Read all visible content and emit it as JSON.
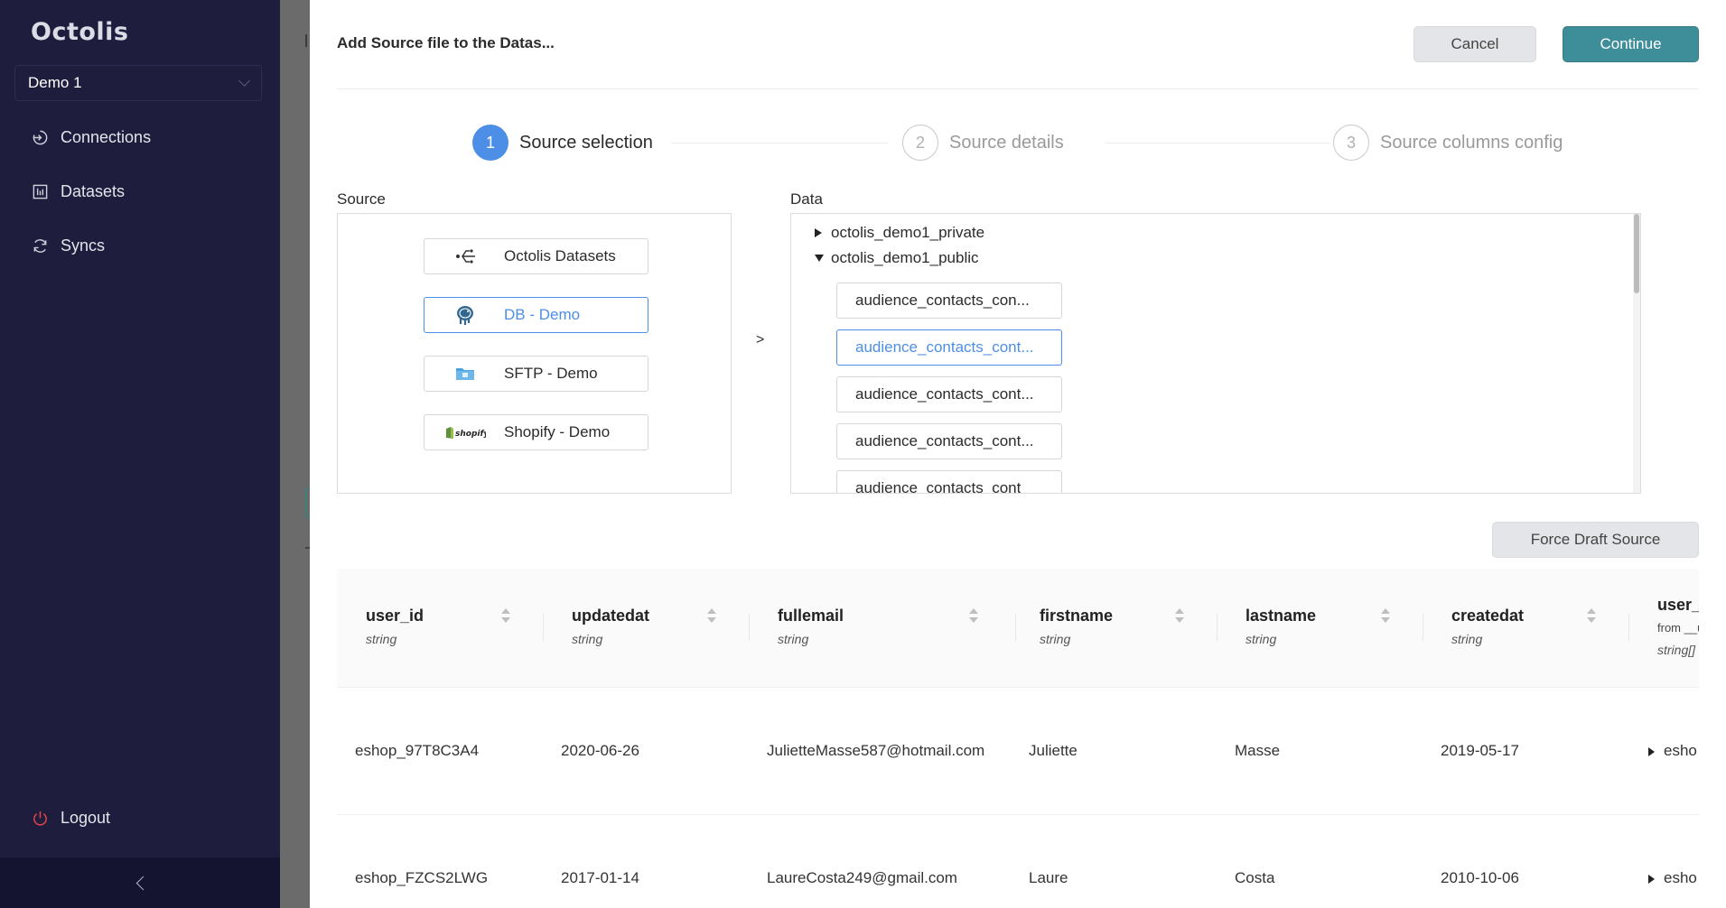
{
  "sidebar": {
    "logo": "Octolis",
    "workspace": "Demo 1",
    "nav": [
      {
        "label": "Connections",
        "icon": "connections-icon"
      },
      {
        "label": "Datasets",
        "icon": "datasets-icon"
      },
      {
        "label": "Syncs",
        "icon": "syncs-icon"
      }
    ],
    "logout": "Logout"
  },
  "drawer": {
    "title": "Add Source file to the Datas...",
    "cancel_label": "Cancel",
    "continue_label": "Continue",
    "force_label": "Force Draft Source"
  },
  "steps": [
    {
      "num": "1",
      "label": "Source selection",
      "state": "active"
    },
    {
      "num": "2",
      "label": "Source details",
      "state": "pending"
    },
    {
      "num": "3",
      "label": "Source columns config",
      "state": "pending"
    }
  ],
  "source": {
    "label": "Source",
    "items": [
      {
        "label": "Octolis Datasets",
        "icon": "octolis-datasets-icon",
        "selected": false
      },
      {
        "label": "DB - Demo",
        "icon": "postgres-elephant-icon",
        "selected": true
      },
      {
        "label": "SFTP - Demo",
        "icon": "folder-icon",
        "selected": false
      },
      {
        "label": "Shopify - Demo",
        "icon": "shopify-logo-icon",
        "selected": false
      }
    ],
    "shopify_logo_text": "shopify",
    "arrow": ">"
  },
  "data": {
    "label": "Data",
    "nodes": [
      {
        "label": "octolis_demo1_private",
        "expanded": false
      },
      {
        "label": "octolis_demo1_public",
        "expanded": true
      }
    ],
    "leaves": [
      {
        "label": "audience_contacts_con...",
        "selected": false
      },
      {
        "label": "audience_contacts_cont...",
        "selected": true
      },
      {
        "label": "audience_contacts_cont...",
        "selected": false
      },
      {
        "label": "audience_contacts_cont...",
        "selected": false
      },
      {
        "label": "audience_contacts_cont",
        "selected": false
      }
    ]
  },
  "table": {
    "columns": [
      {
        "name": "user_id",
        "type": "string"
      },
      {
        "name": "updatedat",
        "type": "string"
      },
      {
        "name": "fullemail",
        "type": "string"
      },
      {
        "name": "firstname",
        "type": "string"
      },
      {
        "name": "lastname",
        "type": "string"
      },
      {
        "name": "createdat",
        "type": "string"
      },
      {
        "name": "user_id",
        "from": "from __u",
        "type": "string[]"
      }
    ],
    "rows": [
      [
        "eshop_97T8C3A4",
        "2020-06-26",
        "JulietteMasse587@hotmail.com",
        "Juliette",
        "Masse",
        "2019-05-17",
        "esho"
      ],
      [
        "eshop_FZCS2LWG",
        "2017-01-14",
        "LaureCosta249@gmail.com",
        "Laure",
        "Costa",
        "2010-10-06",
        "esho"
      ]
    ]
  },
  "colors": {
    "sidebar_bg": "#1e1d3d",
    "accent": "#4d8fe6",
    "continue_bg": "#3e8e9a"
  }
}
